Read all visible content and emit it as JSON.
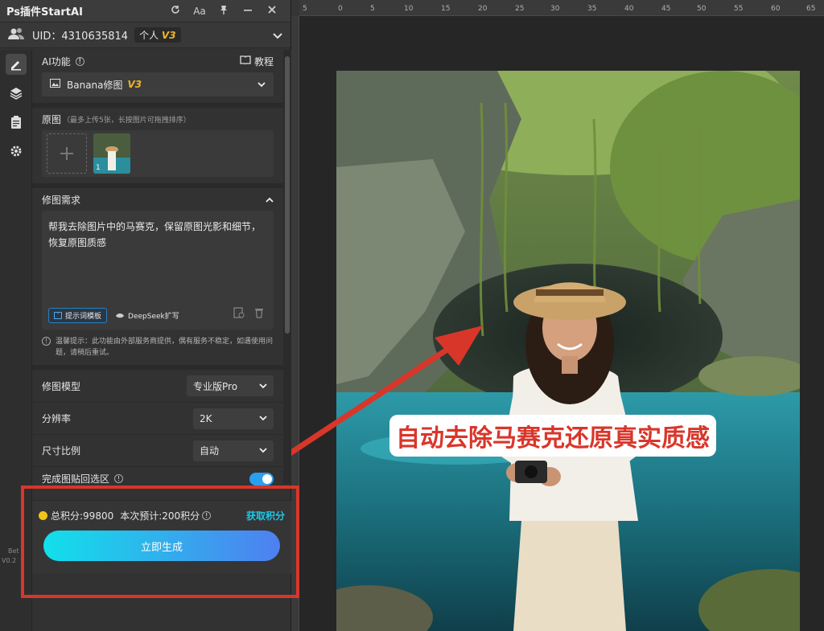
{
  "app": {
    "title": "Ps插件StartAI",
    "title_buttons": [
      "refresh-icon",
      "font-icon",
      "pin-icon",
      "minimize-icon",
      "close-icon"
    ],
    "title_font_label": "Aa"
  },
  "user": {
    "uid_text": "UID：4310635814",
    "plan_label": "个人",
    "plan_version": "V3"
  },
  "ai": {
    "section_label": "AI功能",
    "tutorial_label": "教程",
    "selected_feature": "Banana修图",
    "feature_version": "V3"
  },
  "source": {
    "label": "原图",
    "hint": "（最多上传5张，长按图片可拖拽排序）",
    "thumb_index": "1"
  },
  "prompt": {
    "label": "修图需求",
    "text": "帮我去除图片中的马赛克，保留原图光影和细节，恢复原图质感",
    "template_button": "提示词模板",
    "deepseek_button": "DeepSeek扩写"
  },
  "notice": {
    "text": "温馨提示：此功能由外部服务商提供，偶有服务不稳定，如遇使用问题，请稍后重试。"
  },
  "settings": {
    "model_label": "修图模型",
    "model_value": "专业版Pro",
    "resolution_label": "分辨率",
    "resolution_value": "2K",
    "ratio_label": "尺寸比例",
    "ratio_value": "自动",
    "paste_label": "完成图贴回选区",
    "paste_enabled": true
  },
  "credits": {
    "total_text": "总积分:99800",
    "estimate_text": "本次预计:200积分",
    "get_link": "获取积分",
    "generate_button": "立即生成"
  },
  "side_version": {
    "beta": "Bet",
    "version": "V0.2"
  },
  "ruler": {
    "ticks": [
      "5",
      "0",
      "5",
      "10",
      "15",
      "20",
      "25",
      "30",
      "35",
      "40",
      "45",
      "50",
      "55",
      "60",
      "65"
    ]
  },
  "annotation": {
    "text": "自动去除马赛克还原真实质感"
  },
  "colors": {
    "accent_cyan": "#1fc7e6",
    "annotation_red": "#d9362a",
    "version_gold": "#f0b429"
  }
}
